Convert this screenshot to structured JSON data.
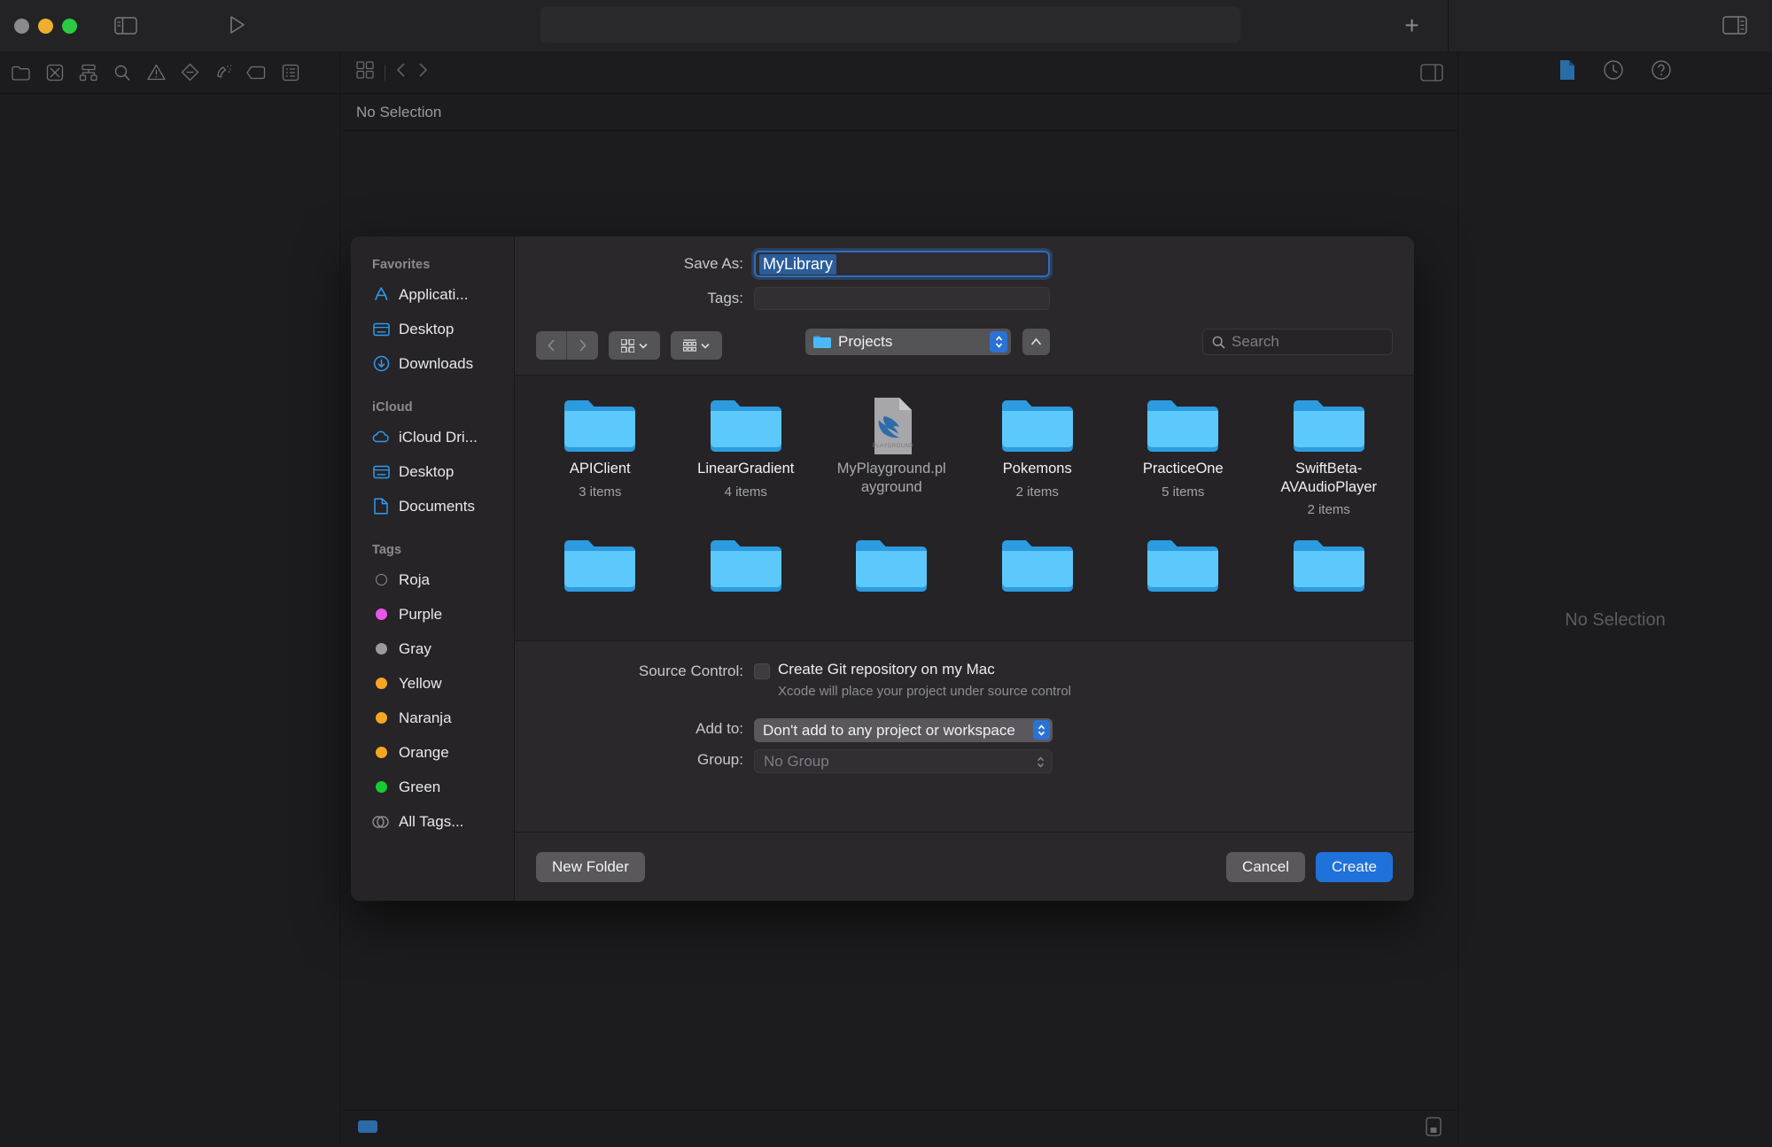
{
  "window": {
    "title_placeholder": "",
    "traffic_lights": [
      {
        "name": "close",
        "color": "#8a8a8e"
      },
      {
        "name": "minimize",
        "color": "#f0ae2f"
      },
      {
        "name": "zoom",
        "color": "#2bcc43"
      }
    ],
    "navigator_icons": [
      "folder-icon",
      "source-control-icon",
      "hierarchy-icon",
      "search-icon",
      "warning-icon",
      "test-icon",
      "debug-icon",
      "breakpoint-icon",
      "report-icon"
    ],
    "editor": {
      "breadcrumb": "No Selection",
      "jumpbar_icons": [
        "grid-icon",
        "chevron-left-icon",
        "chevron-right-icon"
      ]
    },
    "inspector": {
      "empty_text": "No Selection",
      "icons": [
        "file-inspector-icon",
        "history-inspector-icon",
        "quick-help-icon"
      ]
    },
    "add_tab_label": "+"
  },
  "dialog": {
    "sidebar": {
      "sections": [
        {
          "header": "Favorites",
          "items": [
            {
              "label": "Applicati...",
              "icon": "applications-icon",
              "color": "#2d9bf0"
            },
            {
              "label": "Desktop",
              "icon": "desktop-icon",
              "color": "#2d9bf0"
            },
            {
              "label": "Downloads",
              "icon": "downloads-icon",
              "color": "#2d9bf0"
            }
          ]
        },
        {
          "header": "iCloud",
          "items": [
            {
              "label": "iCloud Dri...",
              "icon": "icloud-icon",
              "color": "#2d9bf0"
            },
            {
              "label": "Desktop",
              "icon": "desktop-icon",
              "color": "#2d9bf0"
            },
            {
              "label": "Documents",
              "icon": "document-icon",
              "color": "#2d9bf0"
            }
          ]
        },
        {
          "header": "Tags",
          "items": [
            {
              "label": "Roja",
              "icon": "tag-ring-icon",
              "color": "none"
            },
            {
              "label": "Purple",
              "icon": "tag-dot-icon",
              "color": "#e857e8"
            },
            {
              "label": "Gray",
              "icon": "tag-dot-icon",
              "color": "#9a9a9f"
            },
            {
              "label": "Yellow",
              "icon": "tag-dot-icon",
              "color": "#f5a623"
            },
            {
              "label": "Naranja",
              "icon": "tag-dot-icon",
              "color": "#f5a623"
            },
            {
              "label": "Orange",
              "icon": "tag-dot-icon",
              "color": "#f5a623"
            },
            {
              "label": "Green",
              "icon": "tag-dot-icon",
              "color": "#16cc32"
            },
            {
              "label": "All Tags...",
              "icon": "all-tags-icon",
              "color": "none"
            }
          ]
        }
      ]
    },
    "fields": {
      "save_as_label": "Save As:",
      "save_as_value": "MyLibrary",
      "tags_label": "Tags:",
      "tags_value": ""
    },
    "toolbar": {
      "back_icon": "chevron-left-icon",
      "forward_icon": "chevron-right-icon",
      "view_icon": "icon-view-icon",
      "group_icon": "list-view-icon",
      "path_label": "Projects",
      "up_icon": "chevron-up-icon",
      "search_placeholder": "Search"
    },
    "files": [
      {
        "name": "APIClient",
        "count": "3 items",
        "kind": "folder"
      },
      {
        "name": "LinearGradient",
        "count": "4 items",
        "kind": "folder"
      },
      {
        "name": "MyPlayground.playground",
        "count": "",
        "kind": "playground"
      },
      {
        "name": "Pokemons",
        "count": "2 items",
        "kind": "folder"
      },
      {
        "name": "PracticeOne",
        "count": "5 items",
        "kind": "folder"
      },
      {
        "name": "SwiftBeta-AVAudioPlayer",
        "count": "2 items",
        "kind": "folder"
      },
      {
        "name": "",
        "count": "",
        "kind": "folder"
      },
      {
        "name": "",
        "count": "",
        "kind": "folder"
      },
      {
        "name": "",
        "count": "",
        "kind": "folder"
      },
      {
        "name": "",
        "count": "",
        "kind": "folder"
      },
      {
        "name": "",
        "count": "",
        "kind": "folder"
      },
      {
        "name": "",
        "count": "",
        "kind": "folder"
      }
    ],
    "options": {
      "source_control_label": "Source Control:",
      "git_checkbox_label": "Create Git repository on my Mac",
      "git_checkbox_checked": false,
      "git_sub_text": "Xcode will place your project under source control",
      "add_to_label": "Add to:",
      "add_to_value": "Don't add to any project or workspace",
      "group_label": "Group:",
      "group_value": "No Group",
      "group_disabled": true
    },
    "footer": {
      "new_folder_label": "New Folder",
      "cancel_label": "Cancel",
      "create_label": "Create"
    },
    "accent_color": "#1f72d9",
    "playground_icon_label": "PLAYGROUND"
  }
}
